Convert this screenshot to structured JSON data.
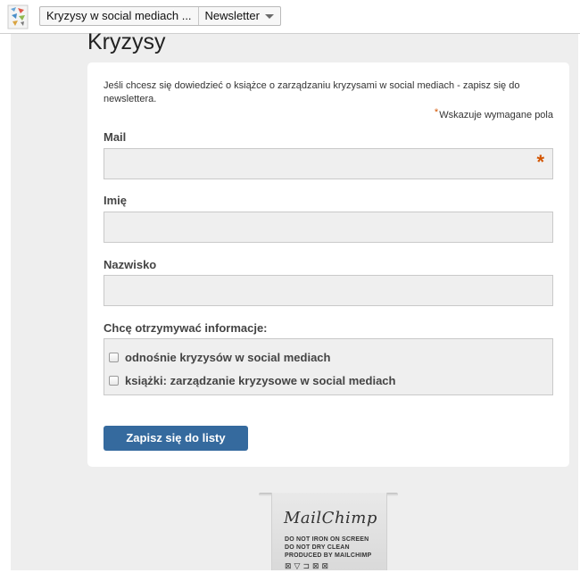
{
  "header": {
    "page_icon": "page-thumbnail-icon",
    "breadcrumb": {
      "item1": "Kryzysy w social mediach ...",
      "item2": "Newsletter",
      "dropdown_icon": "chevron-down-icon"
    }
  },
  "page": {
    "title": "Kryzysy",
    "intro": "Jeśli chcesz się dowiedzieć o książce o zarządzaniu kryzysami w social mediach - zapisz się do newslettera.",
    "required_marker": "*",
    "required_note": "Wskazuje wymagane pola"
  },
  "form": {
    "mail_label": "Mail",
    "mail_required_marker": "*",
    "imie_label": "Imię",
    "nazwisko_label": "Nazwisko",
    "group_label": "Chcę otrzymywać informacje:",
    "options": [
      {
        "label": "odnośnie kryzysów w social mediach",
        "checked": false
      },
      {
        "label": "książki: zarządzanie kryzysowe w social mediach",
        "checked": false
      }
    ],
    "submit_label": "Zapisz się do listy"
  },
  "badge": {
    "logo_text": "MailChimp",
    "lines": [
      "DO NOT IRON ON SCREEN",
      "DO NOT DRY CLEAN",
      "PRODUCED BY MAILCHIMP"
    ]
  },
  "colors": {
    "accent": "#356a9e",
    "required": "#d35400",
    "background": "#eeeeee",
    "card": "#ffffff"
  }
}
